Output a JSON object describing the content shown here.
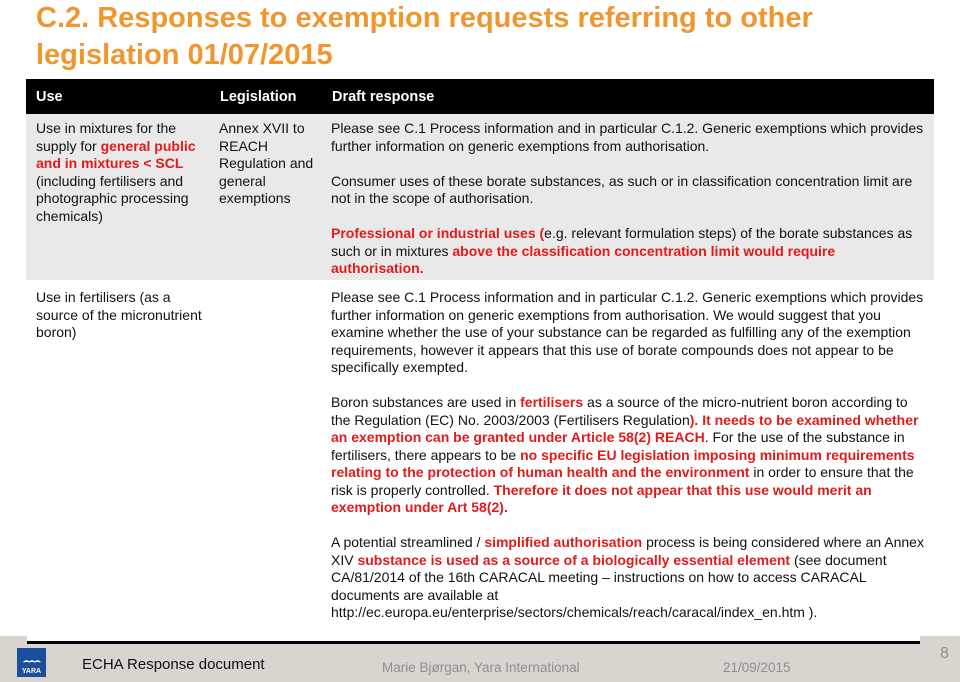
{
  "slide": {
    "title": "C.2. Responses to exemption requests referring to other legislation  01/07/2015"
  },
  "table": {
    "headers": [
      "Use",
      "Legislation",
      "Draft response"
    ],
    "rows": [
      {
        "use": {
          "t1": "Use in mixtures for the supply for ",
          "t2": "general public and in mixtures < SCL",
          "t3": " (including fertilisers and photographic processing chemicals)"
        },
        "legislation": "Annex XVII to REACH Regulation and general exemptions",
        "response": {
          "p1": "Please see C.1 Process information and in particular C.1.2. Generic exemptions which provides further information on generic exemptions from authorisation.",
          "p2": "Consumer uses of these borate substances, as such or in classification concentration limit are not in the scope of authorisation.",
          "p3": {
            "a": "Professional or industrial uses (",
            "b": "e.g. relevant formulation steps) of the borate substances as such or in mixtures ",
            "c": "above the classification concentration limit would require authorisation."
          }
        }
      },
      {
        "use": "Use in fertilisers (as a source of the micronutrient boron)",
        "legislation": "",
        "response": {
          "p1": "Please see C.1 Process information and in particular C.1.2. Generic exemptions which provides further information on generic exemptions from authorisation. We would suggest that you examine whether the use of your substance can be regarded as fulfilling any of the exemption requirements, however it appears that this use of borate compounds does not appear to be specifically exempted.",
          "p2": {
            "a": "Boron substances are used in ",
            "b": "fertilisers",
            "c": " as a source of the micro-nutrient boron according to the Regulation (EC) No. 2003/2003 (Fertilisers Regulation",
            "d": "). It needs to be examined whether an exemption can be granted under Article 58(2) REACH",
            "e": ". For the use of the substance in fertilisers, there appears to be ",
            "f": "no specific EU legislation imposing minimum requirements relating to the protection of human health and the environment",
            "g": " in order to ensure that the risk is properly controlled. ",
            "h": "Therefore it does not appear that this use would merit an exemption under Art 58(2)."
          },
          "p3": {
            "a": "A potential streamlined / ",
            "b": "simplified authorisation",
            "c": " process is being considered where an Annex XIV ",
            "d": "substance is used as a source of a biologically essential element",
            "e": " (see document CA/81/2014 of the 16th CARACAL meeting – instructions on how to access CARACAL documents are available at http://ec.europa.eu/enterprise/sectors/chemicals/reach/caracal/index_en.htm )."
          }
        }
      }
    ]
  },
  "footer": {
    "logo_text": "YARA",
    "logo_icon": "viking-ship-icon",
    "document_name": "ECHA Response document",
    "author": "Marie Bjørgan, Yara International",
    "date": "21/09/2015",
    "page_number": "8"
  },
  "colors": {
    "title": "#f0962e",
    "highlight": "#e11a1a",
    "header_bg": "#000000",
    "row_alt_bg": "#e9e9e9",
    "footer_bg": "#d8d4ce",
    "logo_bg": "#1b4f9c"
  }
}
